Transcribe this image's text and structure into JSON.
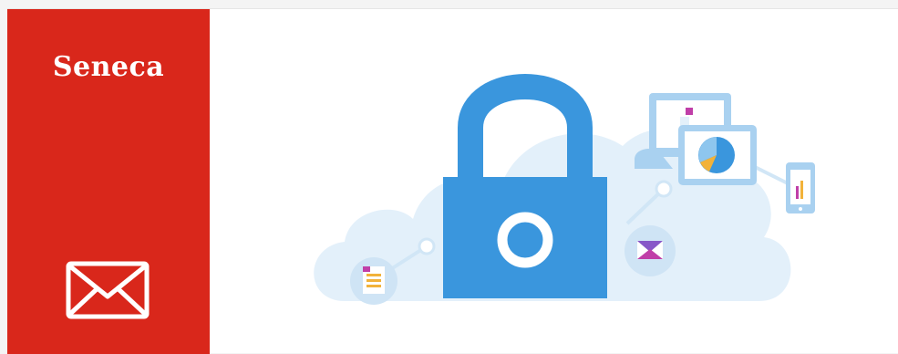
{
  "brand": {
    "name": "Seneca",
    "accent_color": "#d9271b"
  },
  "icons": {
    "mail": "envelope-icon",
    "lock": "padlock-icon",
    "document": "document-icon",
    "message": "envelope-badge-icon",
    "monitor": "monitor-icon",
    "chart_screen": "pie-chart-screen-icon",
    "phone": "phone-icon",
    "cloud": "cloud-icon"
  },
  "colors": {
    "lock_blue": "#3a96dd",
    "cloud_light": "#e3f0fa",
    "device_light": "#a9d1f0"
  }
}
